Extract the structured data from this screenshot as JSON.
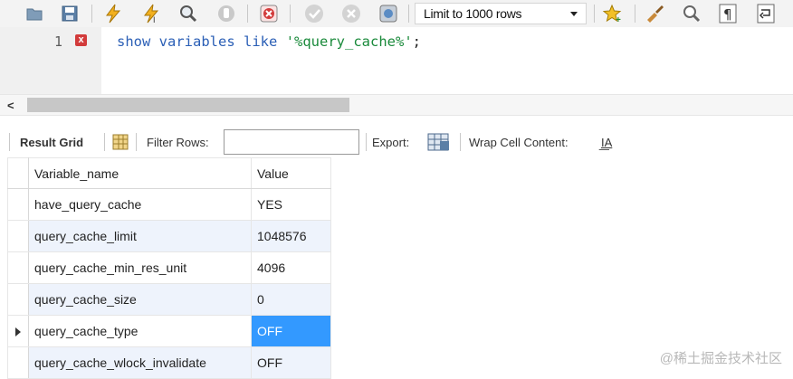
{
  "toolbar": {
    "limit_label": "Limit to 1000 rows",
    "icons": [
      "open-folder-icon",
      "save-icon",
      "execute-icon",
      "execute-selection-icon",
      "explain-icon",
      "stop-icon",
      "toggle-error-icon",
      "commit-icon",
      "rollback-icon",
      "autocommit-icon",
      "bookmark-icon",
      "beautify-icon",
      "find-icon",
      "invisible-chars-icon",
      "wrap-lines-icon"
    ]
  },
  "editor": {
    "line_number": "1",
    "error_marker": "x",
    "tokens": {
      "show": "show",
      "variables": "variables",
      "like": "like",
      "pattern": "'%query_cache%'",
      "end": ";"
    }
  },
  "scrollbar": {
    "left_arrow": "<"
  },
  "result_toolbar": {
    "result_grid_label": "Result Grid",
    "filter_rows_label": "Filter Rows:",
    "filter_value": "",
    "export_label": "Export:",
    "wrap_label": "Wrap Cell Content:",
    "wrap_icon_glyph": "I͟A"
  },
  "grid": {
    "columns": [
      "Variable_name",
      "Value"
    ],
    "rows": [
      {
        "name": "have_query_cache",
        "value": "YES"
      },
      {
        "name": "query_cache_limit",
        "value": "1048576"
      },
      {
        "name": "query_cache_min_res_unit",
        "value": "4096"
      },
      {
        "name": "query_cache_size",
        "value": "0"
      },
      {
        "name": "query_cache_type",
        "value": "OFF"
      },
      {
        "name": "query_cache_wlock_invalidate",
        "value": "OFF"
      }
    ],
    "selected_row": 4
  },
  "watermark": "@稀土掘金技术社区",
  "colors": {
    "keyword": "#2b5fb6",
    "string": "#1a8a3b",
    "selection": "#3399ff",
    "alt_row": "#eef3fc"
  }
}
